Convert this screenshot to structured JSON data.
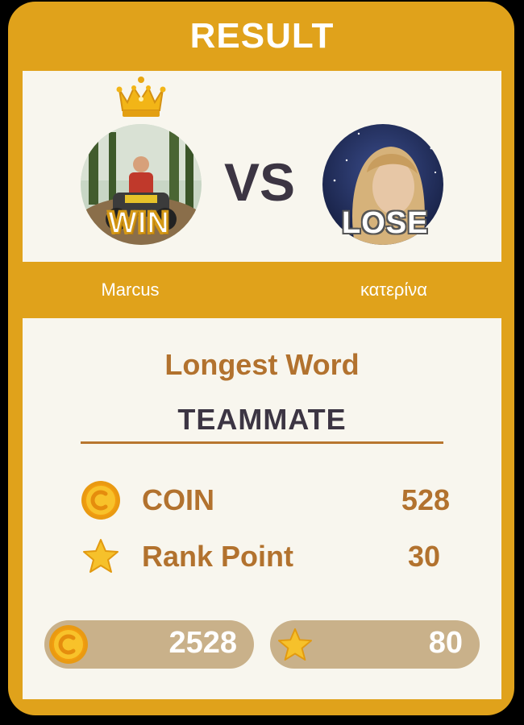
{
  "header": {
    "title": "RESULT"
  },
  "players": {
    "left": {
      "name": "Marcus",
      "badge": "WIN",
      "crown_icon": "crown-icon",
      "colors": {
        "avatar_bg": "#5a7d3a"
      }
    },
    "right": {
      "name": "κατερίνα",
      "badge": "LOSE",
      "colors": {
        "avatar_bg": "#1f2f5c"
      }
    },
    "vs_label": "VS"
  },
  "longest_word": {
    "label": "Longest Word",
    "word": "TEAMMATE"
  },
  "rewards": [
    {
      "icon": "coin-icon",
      "label": "COIN",
      "value": "528"
    },
    {
      "icon": "star-icon",
      "label": "Rank Point",
      "value": "30"
    }
  ],
  "totals": {
    "coins": {
      "icon": "coin-icon",
      "value": "2528"
    },
    "rank_points": {
      "icon": "star-icon",
      "value": "80"
    }
  },
  "colors": {
    "frame": "#e0a21b",
    "panel": "#f8f6ee",
    "accent_text": "#b2722e",
    "dark_text": "#3c3543",
    "pill": "#c9b18a"
  }
}
